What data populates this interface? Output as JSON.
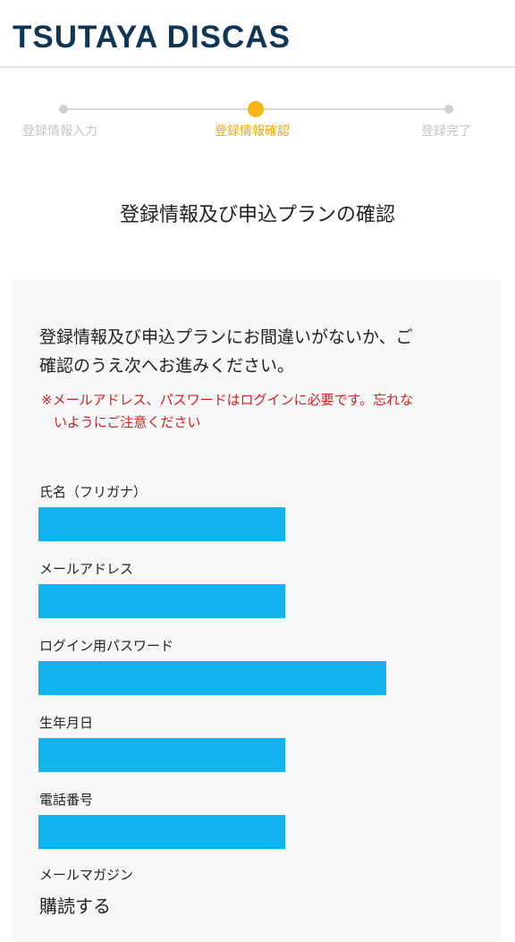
{
  "header": {
    "logo_text": "TSUTAYA DISCAS"
  },
  "steps": [
    {
      "label": "登録情報入力",
      "state": "done"
    },
    {
      "label": "登録情報確認",
      "state": "active"
    },
    {
      "label": "登録完了",
      "state": "pending"
    }
  ],
  "page": {
    "title": "登録情報及び申込プランの確認"
  },
  "panel": {
    "intro_line1": "登録情報及び申込プランにお間違いがないか、ご",
    "intro_line2": "確認のうえ次へお進みください。",
    "warning_line1": "※メールアドレス、パスワードはログインに必要です。忘れな",
    "warning_line2": "いようにご注意ください",
    "fields": [
      {
        "label": "氏名（フリガナ）",
        "value": ""
      },
      {
        "label": "メールアドレス",
        "value": ""
      },
      {
        "label": "ログイン用パスワード",
        "value": ""
      },
      {
        "label": "生年月日",
        "value": ""
      },
      {
        "label": "電話番号",
        "value": ""
      },
      {
        "label": "メールマガジン",
        "value": "購読する"
      }
    ]
  },
  "colors": {
    "brand": "#0f3557",
    "accent": "#f7b514",
    "warning": "#d12020",
    "redaction": "#12b3f0"
  }
}
